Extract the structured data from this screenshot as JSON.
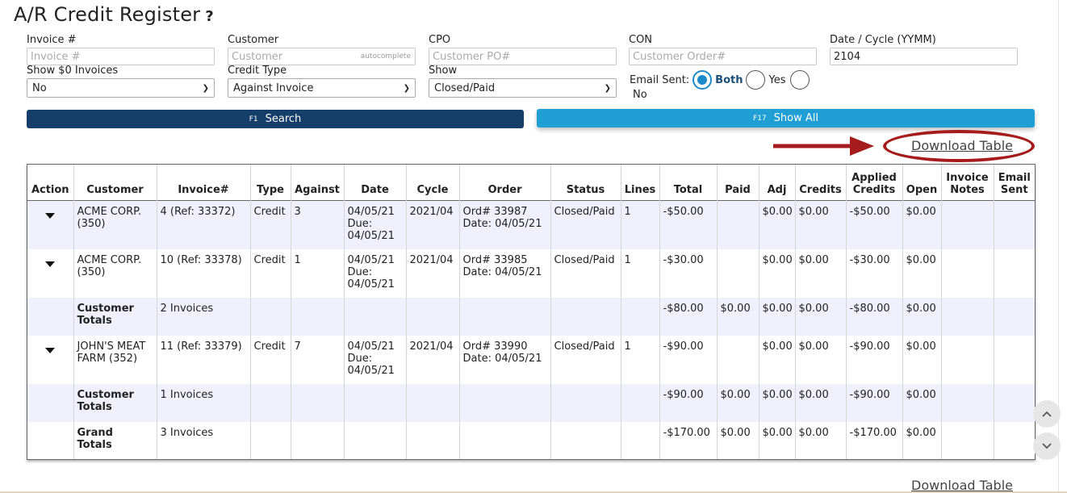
{
  "page": {
    "title": "A/R Credit Register",
    "help": "?"
  },
  "filters": {
    "invoice": {
      "label": "Invoice #",
      "placeholder": "Invoice #",
      "value": ""
    },
    "customer": {
      "label": "Customer",
      "placeholder": "Customer",
      "value": "",
      "hint": "autocomplete"
    },
    "cpo": {
      "label": "CPO",
      "placeholder": "Customer PO#",
      "value": ""
    },
    "con": {
      "label": "CON",
      "placeholder": "Customer Order#",
      "value": ""
    },
    "date_cycle": {
      "label": "Date / Cycle (YYMM)",
      "placeholder": "",
      "value": "2104"
    },
    "show_zero": {
      "label": "Show $0 Invoices",
      "selected": "No"
    },
    "credit_type": {
      "label": "Credit Type",
      "selected": "Against Invoice"
    },
    "show": {
      "label": "Show",
      "selected": "Closed/Paid"
    },
    "email_sent": {
      "label": "Email Sent:",
      "options": [
        "Both",
        "Yes",
        "No"
      ],
      "selected": "Both"
    }
  },
  "buttons": {
    "search": {
      "key": "F1",
      "label": "Search"
    },
    "show_all": {
      "key": "F17",
      "label": "Show All"
    }
  },
  "download": {
    "top": "Download Table",
    "bottom": "Download Table"
  },
  "table": {
    "headers": {
      "action": "Action",
      "customer": "Customer",
      "invoice": "Invoice#",
      "type": "Type",
      "against": "Against",
      "date": "Date",
      "cycle": "Cycle",
      "order": "Order",
      "status": "Status",
      "lines": "Lines",
      "total": "Total",
      "paid": "Paid",
      "adj": "Adj",
      "credits": "Credits",
      "applied_1": "Applied",
      "applied_2": "Credits",
      "open": "Open",
      "notes_1": "Invoice",
      "notes_2": "Notes",
      "email_1": "Email",
      "email_2": "Sent"
    },
    "rows": [
      {
        "customer_1": "ACME CORP.",
        "customer_2": "(350)",
        "invoice": "4 (Ref: 33372)",
        "type": "Credit",
        "against": "3",
        "date_1": "04/05/21",
        "date_2": "Due:",
        "date_3": "04/05/21",
        "cycle": "2021/04",
        "order_1": "Ord# 33987",
        "order_2": "Date: 04/05/21",
        "status": "Closed/Paid",
        "lines": "1",
        "total": "-$50.00",
        "paid": "",
        "adj": "$0.00",
        "credits": "$0.00",
        "applied": "-$50.00",
        "open": "$0.00"
      },
      {
        "customer_1": "ACME CORP.",
        "customer_2": "(350)",
        "invoice": "10 (Ref: 33378)",
        "type": "Credit",
        "against": "1",
        "date_1": "04/05/21",
        "date_2": "Due:",
        "date_3": "04/05/21",
        "cycle": "2021/04",
        "order_1": "Ord# 33985",
        "order_2": "Date: 04/05/21",
        "status": "Closed/Paid",
        "lines": "1",
        "total": "-$30.00",
        "paid": "",
        "adj": "$0.00",
        "credits": "$0.00",
        "applied": "-$30.00",
        "open": "$0.00"
      },
      {
        "customer_1": "Customer",
        "customer_2": "Totals",
        "invoice": "2 Invoices",
        "total": "-$80.00",
        "paid": "$0.00",
        "adj": "$0.00",
        "credits": "$0.00",
        "applied": "-$80.00",
        "open": "$0.00"
      },
      {
        "customer_1": "JOHN'S MEAT",
        "customer_2": "FARM (352)",
        "invoice": "11 (Ref: 33379)",
        "type": "Credit",
        "against": "7",
        "date_1": "04/05/21",
        "date_2": "Due:",
        "date_3": "04/05/21",
        "cycle": "2021/04",
        "order_1": "Ord# 33990",
        "order_2": "Date: 04/05/21",
        "status": "Closed/Paid",
        "lines": "1",
        "total": "-$90.00",
        "paid": "",
        "adj": "$0.00",
        "credits": "$0.00",
        "applied": "-$90.00",
        "open": "$0.00"
      },
      {
        "customer_1": "Customer",
        "customer_2": "Totals",
        "invoice": "1 Invoices",
        "total": "-$90.00",
        "paid": "$0.00",
        "adj": "$0.00",
        "credits": "$0.00",
        "applied": "-$90.00",
        "open": "$0.00"
      },
      {
        "customer_1": "Grand",
        "customer_2": "Totals",
        "invoice": "3 Invoices",
        "total": "-$170.00",
        "paid": "$0.00",
        "adj": "$0.00",
        "credits": "$0.00",
        "applied": "-$170.00",
        "open": "$0.00"
      }
    ]
  },
  "icons": {
    "help": "question-mark-icon",
    "dropdown": "chevron-down-icon",
    "row_action": "caret-down-icon",
    "scroll_up": "chevron-up-icon",
    "scroll_down": "chevron-down-icon",
    "annotation": "arrow-right-icon"
  },
  "colors": {
    "search_button": "#163e6b",
    "show_all_button": "#1f9fd4",
    "radio_accent": "#1b8acb",
    "row_shade": "#eff0fb",
    "annotation": "#a61c1c"
  }
}
